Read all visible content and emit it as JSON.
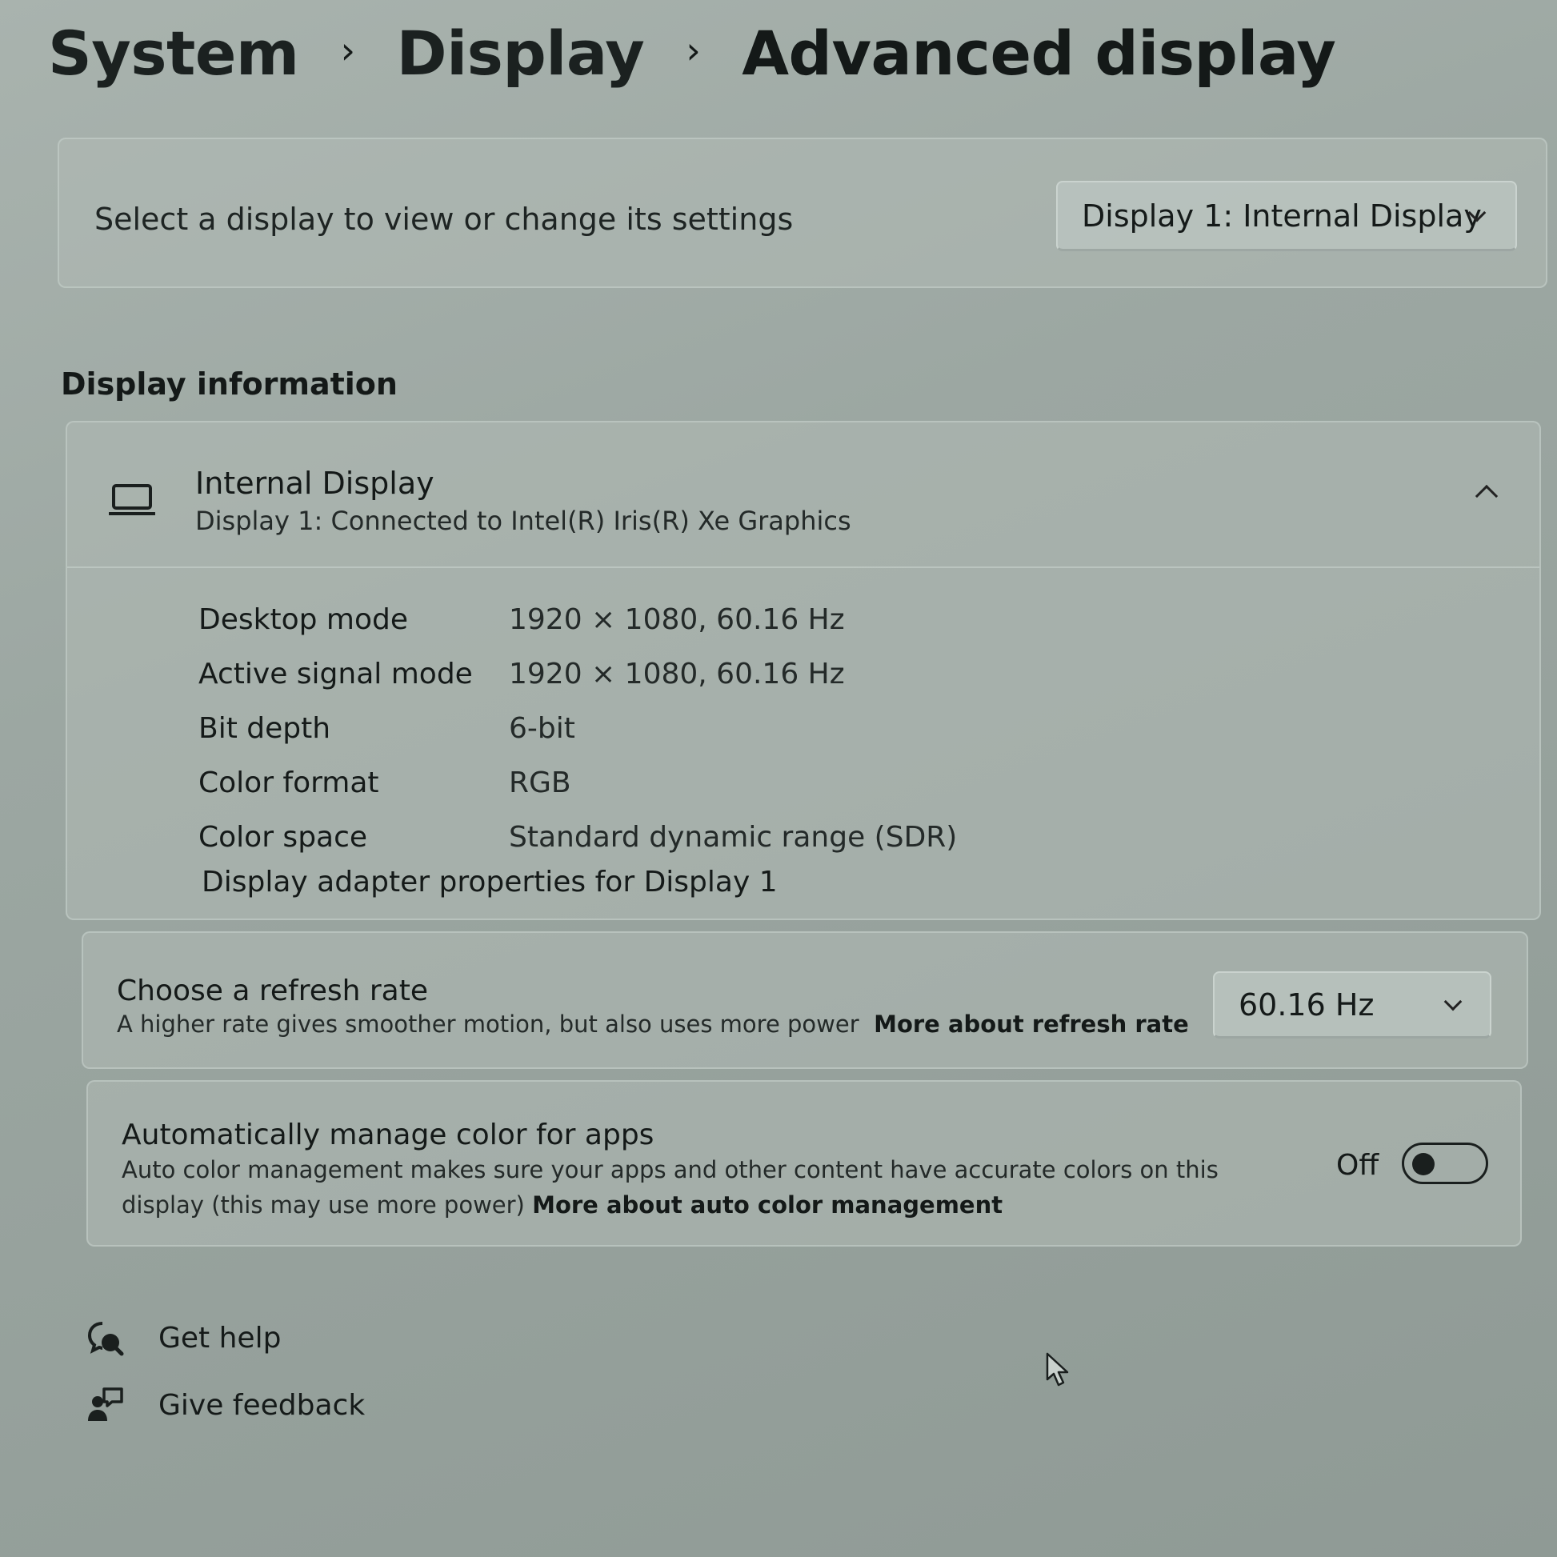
{
  "breadcrumb": {
    "items": [
      "System",
      "Display",
      "Advanced display"
    ],
    "separator": "›"
  },
  "display_select": {
    "label": "Select a display to view or change its settings",
    "selected": "Display 1: Internal Display"
  },
  "display_info": {
    "section_title": "Display information",
    "name": "Internal Display",
    "subtitle": "Display 1: Connected to Intel(R) Iris(R) Xe Graphics",
    "rows": [
      {
        "label": "Desktop mode",
        "value": "1920 × 1080, 60.16 Hz"
      },
      {
        "label": "Active signal mode",
        "value": "1920 × 1080, 60.16 Hz"
      },
      {
        "label": "Bit depth",
        "value": "6-bit"
      },
      {
        "label": "Color format",
        "value": "RGB"
      },
      {
        "label": "Color space",
        "value": "Standard dynamic range (SDR)"
      }
    ],
    "adapter_link": "Display adapter properties for Display 1"
  },
  "refresh_rate": {
    "title": "Choose a refresh rate",
    "description": "A higher rate gives smoother motion, but also uses more power",
    "link": "More about refresh rate",
    "selected": "60.16 Hz"
  },
  "auto_color": {
    "title": "Automatically manage color for apps",
    "description": "Auto color management makes sure your apps and other content have accurate colors on this display (this may use more power)",
    "link": "More about auto color management",
    "state_label": "Off",
    "enabled": false
  },
  "footer": {
    "help": "Get help",
    "feedback": "Give feedback"
  },
  "icons": {
    "display": "laptop-icon",
    "help": "help-icon",
    "feedback": "feedback-icon"
  }
}
